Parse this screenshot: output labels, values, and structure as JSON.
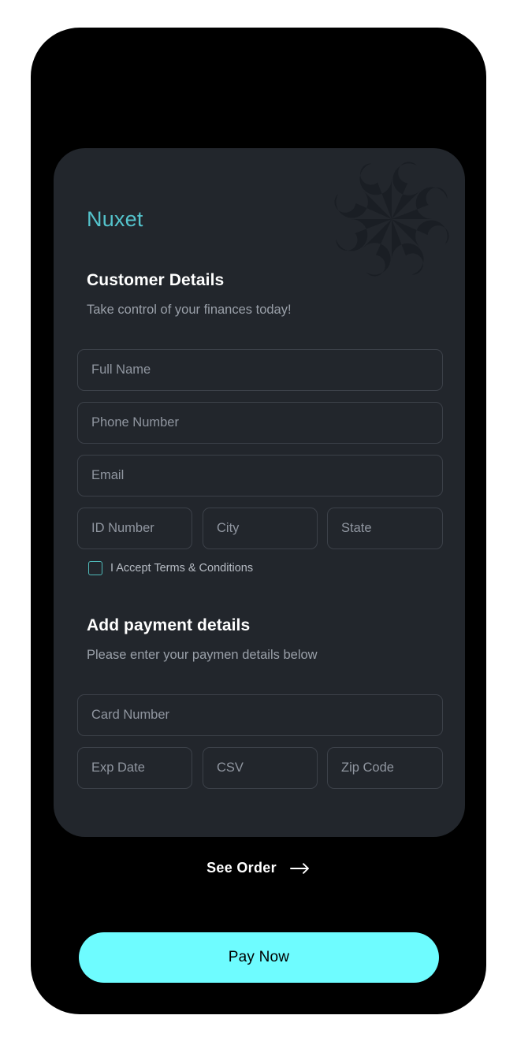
{
  "device": {
    "frame_color": "#ffffff",
    "body_color": "#000000",
    "notch": "notch"
  },
  "theme": {
    "card_bg": "#22262c",
    "accent_cyan": "#6efcff",
    "brand_teal": "#54c3cc",
    "field_border": "#3c4149",
    "placeholder": "#9096a0",
    "heading": "#ffffff",
    "subtext": "#9aa0a9"
  },
  "card": {
    "brand": "Nuxet",
    "logo_icon": "flower-pinwheel-logo-icon",
    "customer": {
      "title": "Customer Details",
      "subtitle": "Take control of your finances today!",
      "fields": {
        "full_name": {
          "placeholder": "Full Name",
          "value": ""
        },
        "phone_number": {
          "placeholder": "Phone Number",
          "value": ""
        },
        "email": {
          "placeholder": "Email",
          "value": ""
        },
        "id_number": {
          "placeholder": "ID Number",
          "value": ""
        },
        "city": {
          "placeholder": "City",
          "value": ""
        },
        "state": {
          "placeholder": "State",
          "value": ""
        }
      },
      "terms": {
        "label": "I Accept Terms & Conditions",
        "checked": false
      }
    },
    "payment": {
      "title": "Add payment details",
      "subtitle": "Please enter your paymen details below",
      "fields": {
        "card_number": {
          "placeholder": "Card Number",
          "value": ""
        },
        "exp_date": {
          "placeholder": "Exp Date",
          "value": ""
        },
        "csv": {
          "placeholder": "CSV",
          "value": ""
        },
        "zip_code": {
          "placeholder": "Zip Code",
          "value": ""
        }
      }
    }
  },
  "footer": {
    "see_order_label": "See Order",
    "see_order_icon": "arrow-right-icon",
    "pay_now_label": "Pay Now"
  }
}
